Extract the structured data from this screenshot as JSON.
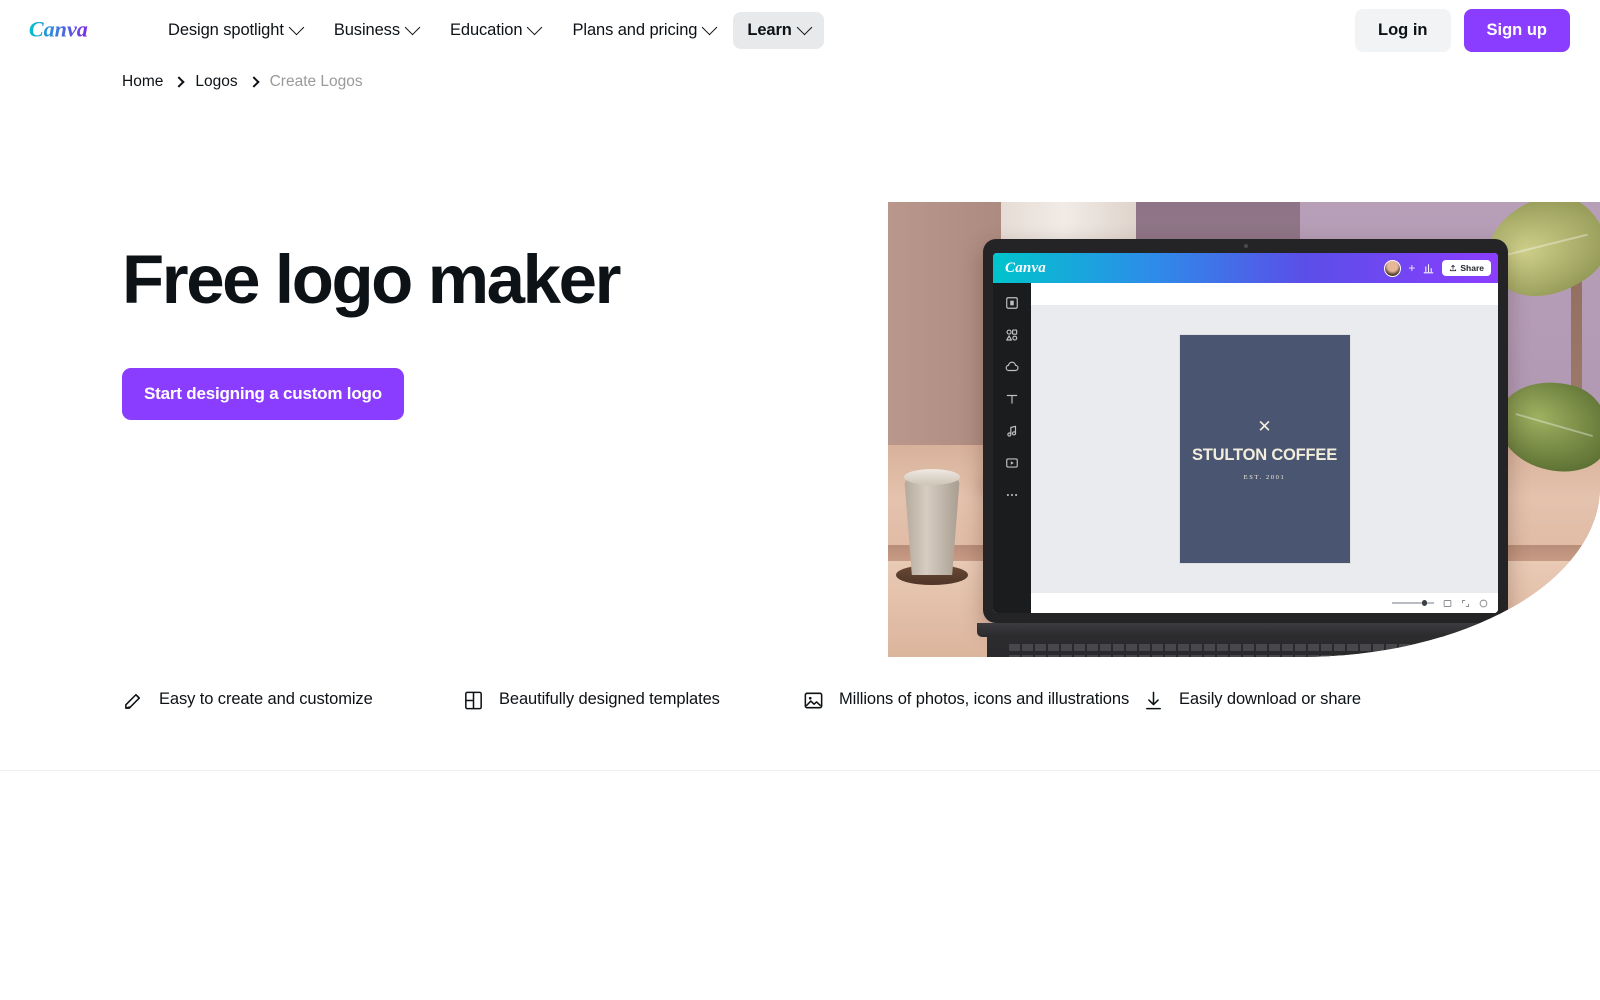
{
  "header": {
    "logo_text": "Canva",
    "nav": [
      {
        "label": "Design spotlight",
        "has_caret": true,
        "active": false
      },
      {
        "label": "Business",
        "has_caret": true,
        "active": false
      },
      {
        "label": "Education",
        "has_caret": true,
        "active": false
      },
      {
        "label": "Plans and pricing",
        "has_caret": true,
        "active": false
      },
      {
        "label": "Learn",
        "has_caret": true,
        "active": true
      }
    ],
    "login_label": "Log in",
    "signup_label": "Sign up"
  },
  "breadcrumb": {
    "items": [
      {
        "label": "Home",
        "current": false
      },
      {
        "label": "Logos",
        "current": false
      },
      {
        "label": "Create Logos",
        "current": true
      }
    ]
  },
  "hero": {
    "title": "Free logo maker",
    "cta_label": "Start designing a custom logo"
  },
  "editor_preview": {
    "brand": "Canva",
    "share_label": "Share",
    "avatar": "user-avatar",
    "rail_icons": [
      "templates-icon",
      "elements-icon",
      "uploads-icon",
      "text-icon",
      "audio-icon",
      "videos-icon",
      "more-icon"
    ],
    "logo_design": {
      "mark": "✕",
      "name": "STULTON COFFEE",
      "established": "EST. 2001",
      "background_color": "#4a5572",
      "text_color": "#f3eedb"
    }
  },
  "features": [
    {
      "icon": "pencil-edit-icon",
      "label": "Easy to create and customize"
    },
    {
      "icon": "layout-template-icon",
      "label": "Beautifully designed templates"
    },
    {
      "icon": "image-photo-icon",
      "label": "Millions of photos, icons and illustrations"
    },
    {
      "icon": "download-icon",
      "label": "Easily download or share"
    }
  ],
  "colors": {
    "brand_purple": "#8b3dff",
    "text_primary": "#0d1216",
    "text_muted": "#9a9a9a",
    "chip_bg": "#e8e9eb",
    "login_bg": "#f2f3f5",
    "divider": "#eceef0",
    "editor_gradient_start": "#00c4cc",
    "editor_gradient_end": "#8b3dff"
  }
}
